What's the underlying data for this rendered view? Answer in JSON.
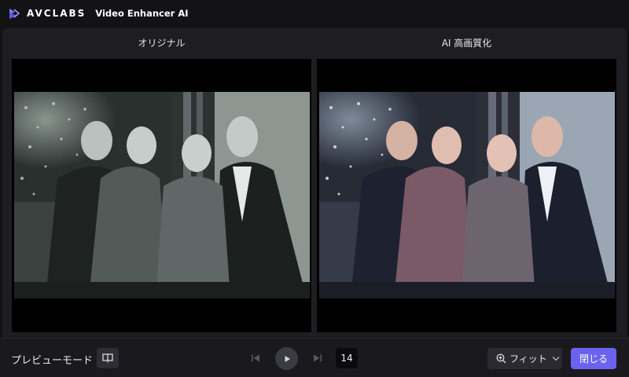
{
  "titlebar": {
    "brand": "AVCLABS",
    "app_title": "Video Enhancer AI",
    "accent": "#6b63ee"
  },
  "preview": {
    "original_label": "オリジナル",
    "enhanced_label": "AI 高画質化"
  },
  "bottom": {
    "mode_label": "プレビューモード",
    "mode_icon": "compare-view-icon",
    "frame_number": "14",
    "zoom_label": "フィット",
    "close_label": "閉じる"
  }
}
